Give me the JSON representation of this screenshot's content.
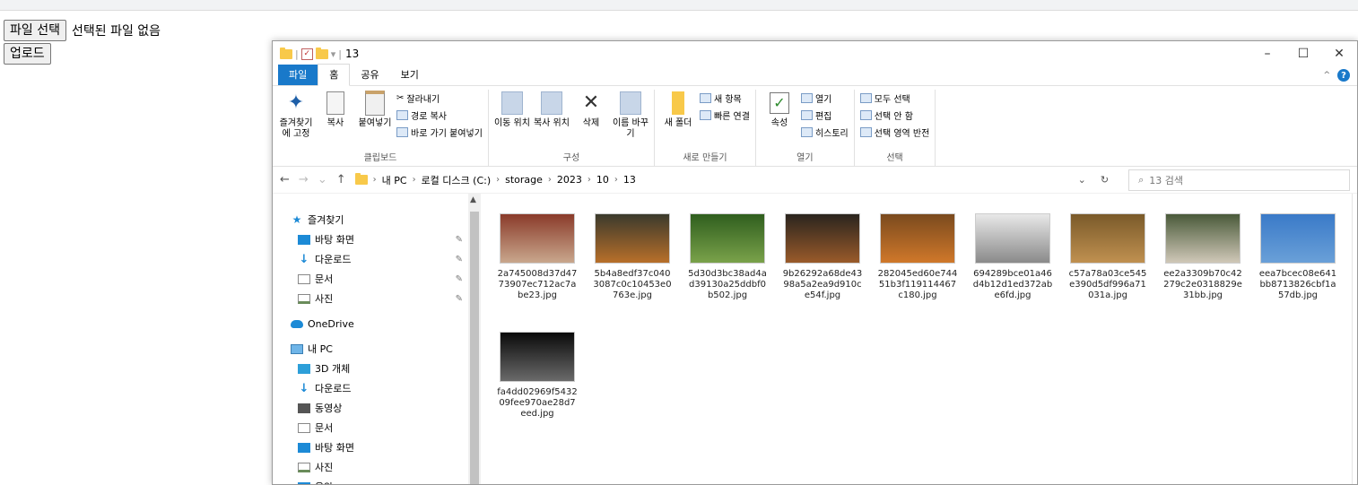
{
  "web": {
    "choose_file_label": "파일 선택",
    "file_status": "선택된 파일 없음",
    "upload_label": "업로드"
  },
  "explorer": {
    "title": "13",
    "window_controls": {
      "minimize": "–",
      "maximize": "☐",
      "close": "✕"
    },
    "tabs": [
      "파일",
      "홈",
      "공유",
      "보기"
    ],
    "ribbon": {
      "clipboard": {
        "label": "클립보드",
        "pin_label": "즐겨찾기에 고정",
        "copy_label": "복사",
        "paste_label": "붙여넣기",
        "cut_label": "잘라내기",
        "copy_path_label": "경로 복사",
        "paste_shortcut_label": "바로 가기 붙여넣기"
      },
      "organize": {
        "label": "구성",
        "move_label": "이동 위치",
        "copy_to_label": "복사 위치",
        "delete_label": "삭제",
        "rename_label": "이름 바꾸기"
      },
      "new": {
        "label": "새로 만들기",
        "new_folder_label": "새 폴더",
        "new_item_label": "새 항목",
        "easy_access_label": "빠른 연결"
      },
      "open": {
        "label": "열기",
        "properties_label": "속성",
        "open_label": "열기",
        "edit_label": "편집",
        "history_label": "히스토리"
      },
      "select": {
        "label": "선택",
        "select_all_label": "모두 선택",
        "select_none_label": "선택 안 함",
        "invert_label": "선택 영역 반전"
      }
    },
    "address": {
      "crumbs": [
        "내 PC",
        "로컬 디스크 (C:)",
        "storage",
        "2023",
        "10",
        "13"
      ],
      "search_placeholder": "13 검색"
    },
    "navpane": {
      "quick_access": "즐겨찾기",
      "quick_items": [
        "바탕 화면",
        "다운로드",
        "문서",
        "사진"
      ],
      "onedrive": "OneDrive",
      "this_pc": "내 PC",
      "pc_items": [
        "3D 개체",
        "다운로드",
        "동영상",
        "문서",
        "바탕 화면",
        "사진",
        "음악"
      ]
    },
    "files": [
      {
        "name": "2a745008d37d4773907ec712ac7abe23.jpg",
        "color_top": "#8a3b2a",
        "color_bottom": "#c9a78d"
      },
      {
        "name": "5b4a8edf37c0403087c0c10453e0763e.jpg",
        "color_top": "#3b3a2c",
        "color_bottom": "#b86f2a"
      },
      {
        "name": "5d30d3bc38ad4ad39130a25ddbf0b502.jpg",
        "color_top": "#2f5e1e",
        "color_bottom": "#7aa24a"
      },
      {
        "name": "9b26292a68de4398a5a2ea9d910ce54f.jpg",
        "color_top": "#2a241e",
        "color_bottom": "#9a5a2a"
      },
      {
        "name": "282045ed60e74451b3f119114467c180.jpg",
        "color_top": "#7a4a1e",
        "color_bottom": "#d0782a"
      },
      {
        "name": "694289bce01a46d4b12d1ed372abe6fd.jpg",
        "color_top": "#e8e8e8",
        "color_bottom": "#8a8a8a"
      },
      {
        "name": "c57a78a03ce545e390d5df996a71031a.jpg",
        "color_top": "#7a5a2a",
        "color_bottom": "#c09050"
      },
      {
        "name": "ee2a3309b70c42279c2e0318829e31bb.jpg",
        "color_top": "#4a5a3a",
        "color_bottom": "#d0c8b8"
      },
      {
        "name": "eea7bcec08e641bb8713826cbf1a57db.jpg",
        "color_top": "#3a7ac8",
        "color_bottom": "#6aa0d8"
      },
      {
        "name": "fa4dd02969f543209fee970ae28d7eed.jpg",
        "color_top": "#0a0a0a",
        "color_bottom": "#6a6a6a"
      }
    ]
  }
}
